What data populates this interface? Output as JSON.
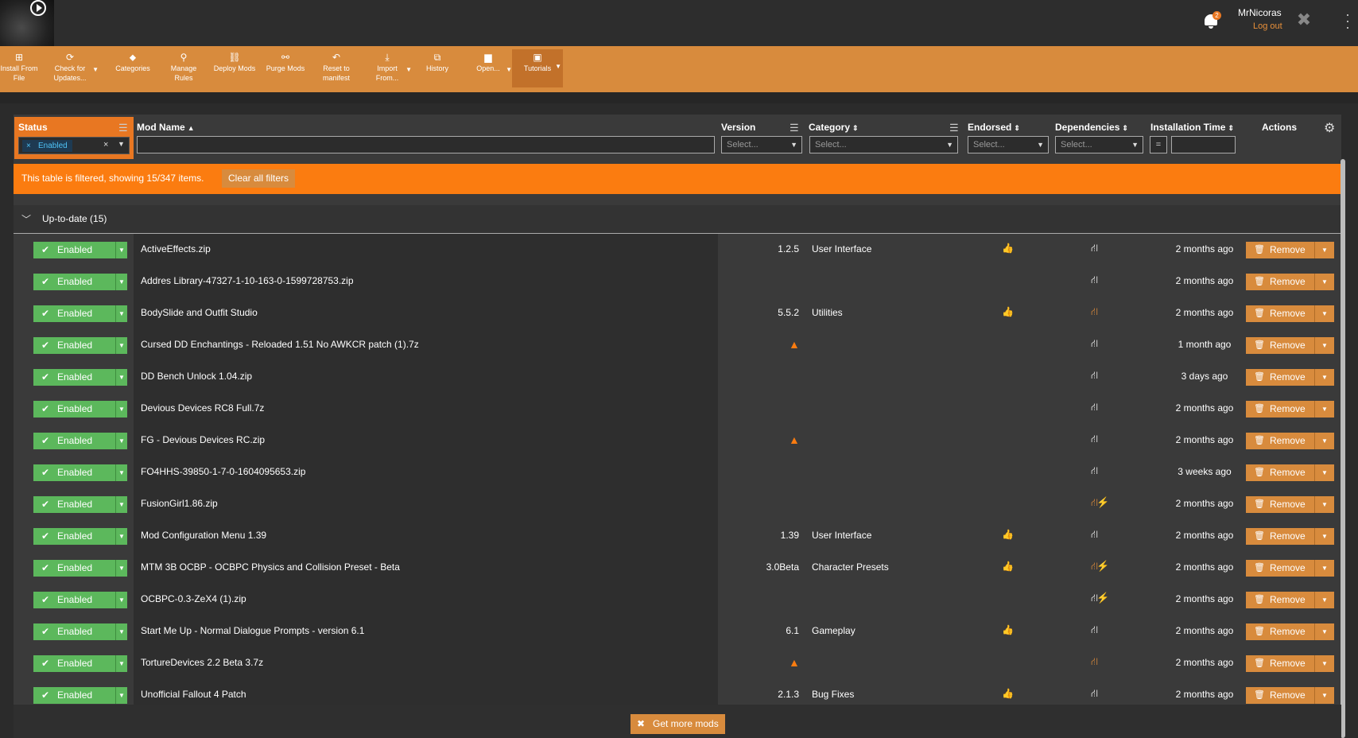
{
  "header": {
    "notification_count": "2",
    "username": "MrNicoras",
    "logout_label": "Log out"
  },
  "toolbar": {
    "install_from_file": "Install From File",
    "check_updates": "Check for Updates...",
    "categories": "Categories",
    "manage_rules": "Manage Rules",
    "deploy_mods": "Deploy Mods",
    "purge_mods": "Purge Mods",
    "reset_manifest": "Reset to manifest",
    "import_from": "Import From...",
    "history": "History",
    "open": "Open...",
    "tutorials": "Tutorials"
  },
  "columns": {
    "status": "Status",
    "mod_name": "Mod Name",
    "version": "Version",
    "category": "Category",
    "endorsed": "Endorsed",
    "dependencies": "Dependencies",
    "installation_time": "Installation Time",
    "actions": "Actions"
  },
  "filters": {
    "status_tag": "Enabled",
    "select_placeholder": "Select...",
    "time_operator": "="
  },
  "filter_banner": {
    "message": "This table is filtered, showing 15/347 items.",
    "clear_label": "Clear all filters"
  },
  "group": {
    "label": "Up-to-date (15)"
  },
  "labels": {
    "enabled": "Enabled",
    "remove": "Remove"
  },
  "colors": {
    "accent": "#d88b3d",
    "filter_orange": "#fb7c10",
    "enabled_green": "#5cb85c"
  },
  "rows": [
    {
      "name": "ActiveEffects.zip",
      "version": "1.2.5",
      "category": "User Interface",
      "endorsed": true,
      "warning": false,
      "dep_state": "normal",
      "time": "2 months ago"
    },
    {
      "name": "Addres Library-47327-1-10-163-0-1599728753.zip",
      "version": "",
      "category": "",
      "endorsed": false,
      "warning": false,
      "dep_state": "normal",
      "time": "2 months ago"
    },
    {
      "name": "BodySlide and Outfit Studio",
      "version": "5.5.2",
      "category": "Utilities",
      "endorsed": true,
      "warning": false,
      "dep_state": "orange",
      "time": "2 months ago"
    },
    {
      "name": "Cursed DD Enchantings - Reloaded 1.51 No AWKCR patch (1).7z",
      "version": "",
      "category": "",
      "endorsed": false,
      "warning": true,
      "dep_state": "normal",
      "time": "1 month ago"
    },
    {
      "name": "DD Bench Unlock 1.04.zip",
      "version": "",
      "category": "",
      "endorsed": false,
      "warning": false,
      "dep_state": "normal",
      "time": "3 days ago"
    },
    {
      "name": "Devious Devices RC8 Full.7z",
      "version": "",
      "category": "",
      "endorsed": false,
      "warning": false,
      "dep_state": "normal",
      "time": "2 months ago"
    },
    {
      "name": "FG - Devious Devices RC.zip",
      "version": "",
      "category": "",
      "endorsed": false,
      "warning": true,
      "dep_state": "normal",
      "time": "2 months ago"
    },
    {
      "name": "FO4HHS-39850-1-7-0-1604095653.zip",
      "version": "",
      "category": "",
      "endorsed": false,
      "warning": false,
      "dep_state": "normal",
      "time": "3 weeks ago"
    },
    {
      "name": "FusionGirl1.86.zip",
      "version": "",
      "category": "",
      "endorsed": false,
      "warning": false,
      "dep_state": "orange-bolt",
      "time": "2 months ago"
    },
    {
      "name": "Mod Configuration Menu 1.39",
      "version": "1.39",
      "category": "User Interface",
      "endorsed": true,
      "warning": false,
      "dep_state": "normal",
      "time": "2 months ago"
    },
    {
      "name": "MTM 3B OCBP - OCBPC Physics and Collision Preset - Beta",
      "version": "3.0Beta",
      "category": "Character Presets",
      "endorsed": true,
      "warning": false,
      "dep_state": "orange-bolt",
      "time": "2 months ago"
    },
    {
      "name": "OCBPC-0.3-ZeX4 (1).zip",
      "version": "",
      "category": "",
      "endorsed": false,
      "warning": false,
      "dep_state": "white-bolt",
      "time": "2 months ago"
    },
    {
      "name": "Start Me Up - Normal Dialogue Prompts - version 6.1",
      "version": "6.1",
      "category": "Gameplay",
      "endorsed": true,
      "warning": false,
      "dep_state": "normal",
      "time": "2 months ago"
    },
    {
      "name": "TortureDevices 2.2 Beta 3.7z",
      "version": "",
      "category": "",
      "endorsed": false,
      "warning": true,
      "dep_state": "orange",
      "time": "2 months ago"
    },
    {
      "name": "Unofficial Fallout 4 Patch",
      "version": "2.1.3",
      "category": "Bug Fixes",
      "endorsed": true,
      "warning": false,
      "dep_state": "normal",
      "time": "2 months ago"
    }
  ],
  "footer": {
    "get_more": "Get more mods"
  }
}
